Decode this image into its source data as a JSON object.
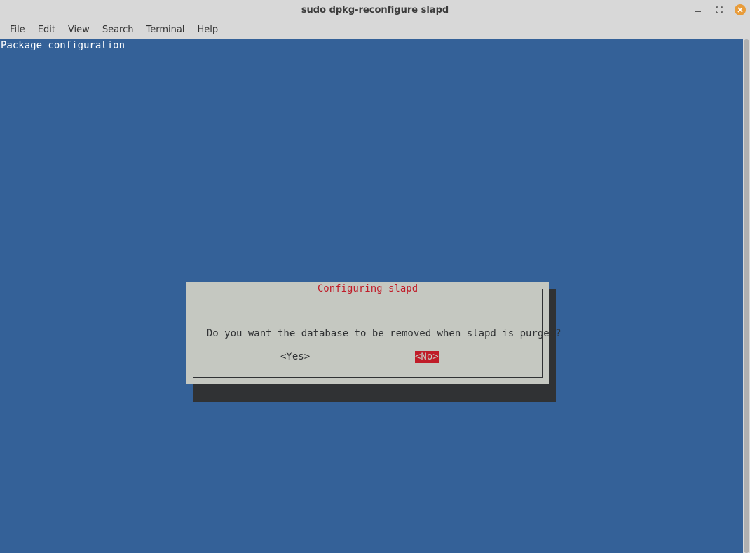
{
  "window": {
    "title": "sudo dpkg-reconfigure slapd"
  },
  "menu": {
    "file": "File",
    "edit": "Edit",
    "view": "View",
    "search": "Search",
    "terminal": "Terminal",
    "help": "Help"
  },
  "terminal": {
    "header_text": "Package configuration"
  },
  "dialog": {
    "title": "Configuring slapd",
    "message": "  Do you want the database to be removed when slapd is purged?",
    "yes_label": "<Yes>",
    "no_label": "<No>",
    "selected": "no"
  },
  "colors": {
    "terminal_bg": "#346198",
    "dialog_bg": "#c5c8c1",
    "dialog_title_fg": "#c01c28",
    "dialog_shadow": "#303234",
    "selected_bg": "#c01c28"
  }
}
